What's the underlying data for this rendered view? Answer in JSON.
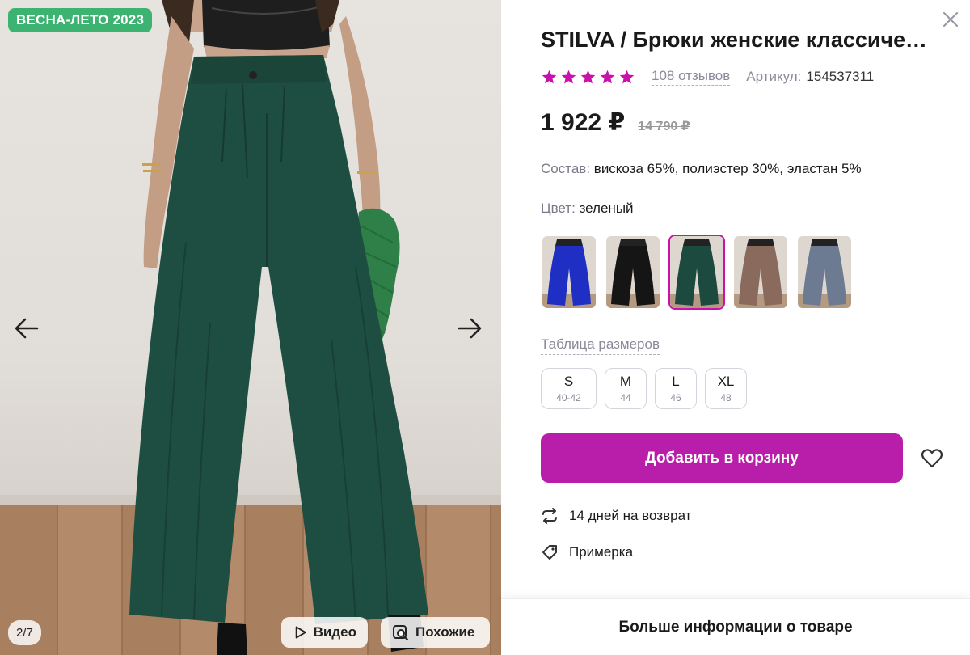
{
  "gallery": {
    "season_badge": "ВЕСНА-ЛЕТО 2023",
    "counter": "2/7",
    "video_label": "Видео",
    "similar_label": "Похожие",
    "prev_icon": "arrow-left-icon",
    "next_icon": "arrow-right-icon"
  },
  "product": {
    "title": "STILVA / Брюки женские классические",
    "rating_stars": 5,
    "star_color": "#cb11ab",
    "reviews": "108 отзывов",
    "article_label": "Артикул:",
    "article_value": "154537311",
    "price": "1 922 ₽",
    "old_price": "14 790 ₽",
    "composition_label": "Состав:",
    "composition_value": "вискоза 65%, полиэстер 30%, эластан 5%",
    "color_label": "Цвет:",
    "color_value": "зеленый",
    "swatches": [
      {
        "name": "blue",
        "color": "#1f2fc4",
        "selected": false
      },
      {
        "name": "black",
        "color": "#151515",
        "selected": false
      },
      {
        "name": "green",
        "color": "#1d4a3e",
        "selected": true
      },
      {
        "name": "brown",
        "color": "#8a6a5c",
        "selected": false
      },
      {
        "name": "grey-blue",
        "color": "#6c7b92",
        "selected": false
      }
    ],
    "size_table_label": "Таблица размеров",
    "sizes": [
      {
        "label": "S",
        "ru": "40-42"
      },
      {
        "label": "M",
        "ru": "44"
      },
      {
        "label": "L",
        "ru": "46"
      },
      {
        "label": "XL",
        "ru": "48"
      }
    ],
    "cart_button": "Добавить в корзину",
    "return_text": "14 дней на возврат",
    "fitting_text": "Примерка",
    "more_info": "Больше информации о товаре",
    "accent_color": "#b91eaa"
  }
}
